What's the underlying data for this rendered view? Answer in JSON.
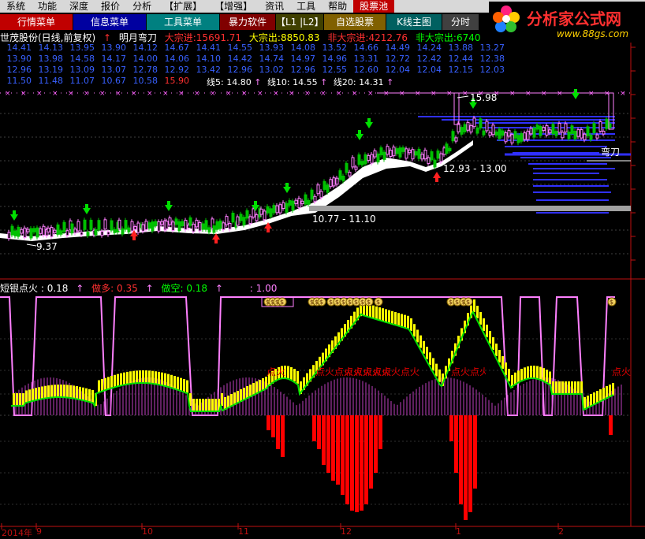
{
  "menu": {
    "items": [
      "系统",
      "功能",
      "深度",
      "报价",
      "分析",
      "【扩展】",
      "【增强】",
      "资讯",
      "工具",
      "帮助",
      "股票池"
    ],
    "active_index": 10
  },
  "toolbar": {
    "buttons": [
      {
        "label": "行情菜单",
        "color": "#c00000",
        "width": 92
      },
      {
        "label": "信息菜单",
        "color": "#0000a0",
        "width": 92
      },
      {
        "label": "工具菜单",
        "color": "#008080",
        "width": 92
      },
      {
        "label": "暴力软件",
        "color": "#800000",
        "width": 70
      },
      {
        "label": "【L1 |L2】",
        "color": "#404000",
        "width": 60
      },
      {
        "label": "自选股票",
        "color": "#806000",
        "width": 78
      },
      {
        "label": "K线主图",
        "color": "#006060",
        "width": 70
      },
      {
        "label": "分时",
        "color": "#404040",
        "width": 46
      }
    ]
  },
  "brand": {
    "title": "分析家公式网",
    "url": "www.88gs.com"
  },
  "info": {
    "stock": "世茂股份(日线,前复权)",
    "indicator": "明月弯刀",
    "big_in_label": "大宗进:",
    "big_in_value": "15691.71",
    "big_out_label": "大宗出:",
    "big_out_value": "8850.83",
    "nonbig_in_label": "非大宗进:",
    "nonbig_in_value": "4212.76",
    "nonbig_out_label": "非大宗出:",
    "nonbig_out_value": "6740"
  },
  "grid_rows": [
    [
      "14.41",
      "14.13",
      "13.95",
      "13.90",
      "14.12",
      "14.67",
      "14.41",
      "14.55",
      "13.93",
      "14.08",
      "13.52",
      "14.66",
      "14.49",
      "14.24",
      "13.88",
      "13.27"
    ],
    [
      "13.90",
      "13.98",
      "14.58",
      "14.17",
      "14.00",
      "14.06",
      "14.10",
      "14.42",
      "14.74",
      "14.97",
      "14.96",
      "13.31",
      "12.72",
      "12.42",
      "12.44",
      "12.38"
    ],
    [
      "12.96",
      "13.19",
      "13.09",
      "13.07",
      "12.78",
      "12.92",
      "13.42",
      "12.96",
      "13.02",
      "12.96",
      "12.55",
      "12.60",
      "12.04",
      "12.04",
      "12.15",
      "12.03"
    ],
    [
      "11.50",
      "11.48",
      "11.07",
      "10.67",
      "10.58",
      "15.90"
    ]
  ],
  "ma": {
    "ma5_label": "线5:",
    "ma5": "14.80",
    "ma10_label": "线10:",
    "ma10": "14.55",
    "ma20_label": "线20:",
    "ma20": "14.31"
  },
  "annotations": {
    "high": "15.98",
    "low": "9.37",
    "range1": "12.93 - 13.00",
    "range2": "10.77 - 11.10",
    "wandao": "弯刀"
  },
  "indicator_panel": {
    "name": "短银点火",
    "value": "0.18",
    "long_label": "做多:",
    "long_value": "0.35",
    "short_label": "做空:",
    "short_value": "0.18",
    "extra_label": ":",
    "extra_value": "1.00",
    "fire_label": "点火",
    "fire_labels": [
      "点火",
      "点火点火点火点火",
      "点火点火点火点火",
      "点火点火点火点火点火"
    ],
    "coin_label": "$"
  },
  "date_axis": {
    "labels": [
      "2014年",
      "9",
      "10",
      "11",
      "12",
      "1",
      "2"
    ]
  },
  "colors": {
    "up": "#ff4040",
    "down": "#00c000",
    "magenta": "#ff80ff",
    "blue": "#3030ff",
    "yellow": "#ffff00",
    "red": "#e00000",
    "green": "#00ff00",
    "white": "#ffffff",
    "gray": "#a0a0a0"
  }
}
